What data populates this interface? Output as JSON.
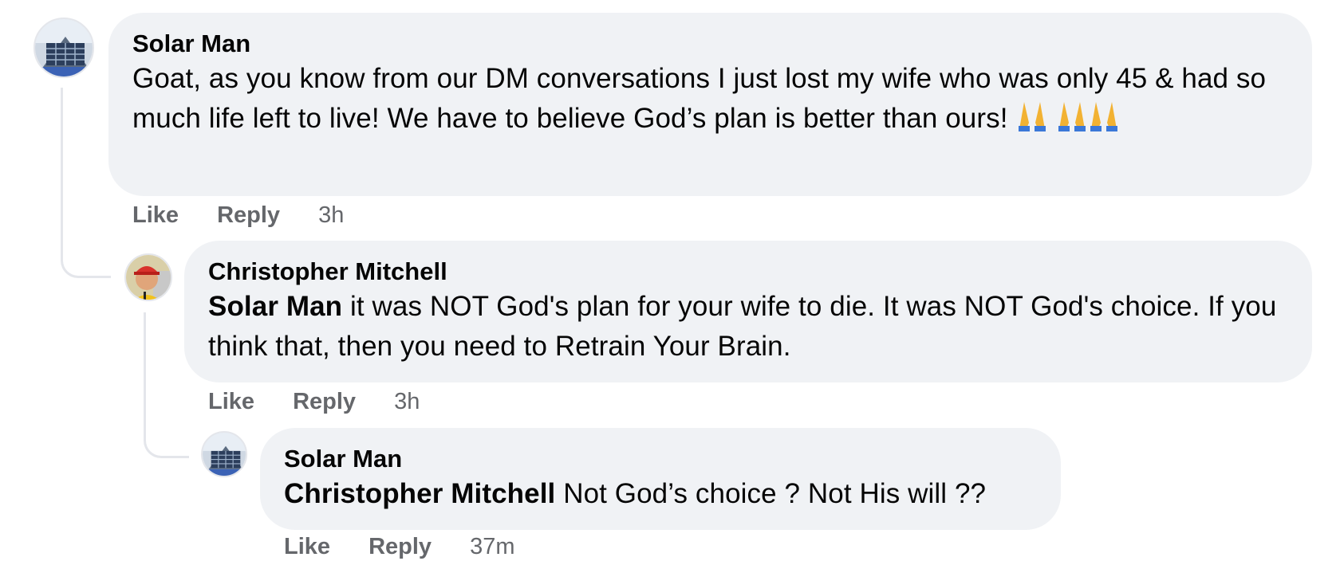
{
  "comments": [
    {
      "author": "Solar Man",
      "mention": "",
      "text": "Goat, as you know from our DM conversations I just lost my wife who was only 45 & had so much life left to live! We have to believe God’s plan is better than ours!",
      "emoji": "pray-emoji",
      "like_label": "Like",
      "reply_label": "Reply",
      "time": "3h"
    },
    {
      "author": "Christopher Mitchell",
      "mention": "Solar Man",
      "text": " it was NOT God's plan for your wife to die. It was NOT God's choice. If you think that, then you need to Retrain Your Brain.",
      "like_label": "Like",
      "reply_label": "Reply",
      "time": "3h"
    },
    {
      "author": "Solar Man",
      "mention": "Christopher Mitchell",
      "text": " Not God’s choice ? Not His will ??",
      "like_label": "Like",
      "reply_label": "Reply",
      "time": "37m"
    }
  ],
  "colors": {
    "bubble": "#f0f2f5",
    "action_gray": "#65676b",
    "thread_line": "#e4e6eb"
  }
}
